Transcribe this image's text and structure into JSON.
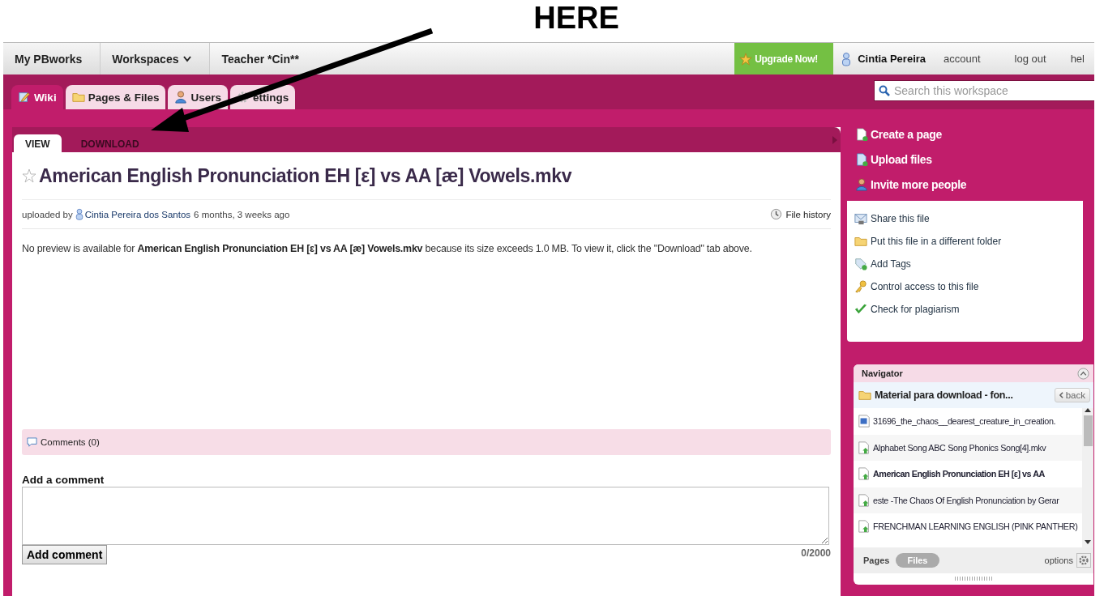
{
  "annotation": {
    "label": "HERE"
  },
  "top_bar": {
    "breadcrumbs": [
      {
        "label": "My PBworks",
        "dropdown": false
      },
      {
        "label": "Workspaces",
        "dropdown": true
      },
      {
        "label": "Teacher *Cin**",
        "dropdown": false
      }
    ],
    "upgrade": "Upgrade Now!",
    "user": "Cintia Pereira",
    "links": [
      "account",
      "log out",
      "hel"
    ]
  },
  "tabs": [
    {
      "label": "Wiki",
      "selected": true
    },
    {
      "label": "Pages & Files",
      "selected": false
    },
    {
      "label": "Users",
      "selected": false
    },
    {
      "label": "ettings",
      "selected": false
    }
  ],
  "search": {
    "placeholder": "Search this workspace"
  },
  "file_view": {
    "tabs": [
      {
        "label": "VIEW",
        "selected": true
      },
      {
        "label": "DOWNLOAD",
        "selected": false
      }
    ],
    "title": "American English Pronunciation EH [ε] vs AA [æ] Vowels.mkv",
    "starred": false,
    "meta": {
      "prefix": "uploaded by",
      "author": "Cintia Pereira dos Santos",
      "age": "6 months, 3 weeks ago"
    },
    "file_history": "File history",
    "notice": "No preview is available for **American English Pronunciation EH [ε] vs AA [æ] Vowels.mkv** because its size exceeds 1.0 MB. To view it, click the \"Download\" tab above.",
    "comments": "Comments (0)",
    "add_comment_label": "Add a comment",
    "button": "Add comment",
    "counter": "0/2000"
  },
  "actions": [
    "Create a page",
    "Upload files",
    "Invite more people"
  ],
  "file_actions": [
    "Share this file",
    "Put this file in a different folder",
    "Add Tags",
    "Control access to this file",
    "Check for plagiarism"
  ],
  "navigator": {
    "title": "Navigator",
    "folder": "Material para download - fon...",
    "back": "back",
    "files": [
      {
        "name": "31696_the_chaos__dearest_creature_in_creation.",
        "kind": "doc",
        "selected": false
      },
      {
        "name": "Alphabet Song ABC Song Phonics Song[4].mkv",
        "kind": "file",
        "selected": false
      },
      {
        "name": "American English Pronunciation EH [ε] vs AA",
        "kind": "file",
        "selected": true
      },
      {
        "name": "este -The Chaos Of English Pronunciation by Gerar",
        "kind": "file",
        "selected": false
      },
      {
        "name": "FRENCHMAN LEARNING ENGLISH (PINK PANTHER)",
        "kind": "file",
        "selected": false
      }
    ],
    "footer_tabs": [
      {
        "label": "Pages",
        "selected": false
      },
      {
        "label": "Files",
        "selected": true
      }
    ],
    "options": "options"
  }
}
